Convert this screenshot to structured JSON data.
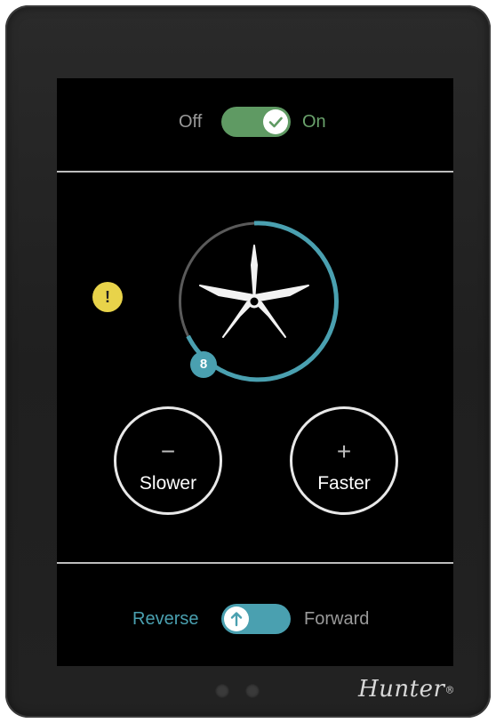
{
  "power": {
    "off_label": "Off",
    "on_label": "On",
    "state": "on"
  },
  "fan": {
    "speed": "8"
  },
  "warning": {
    "symbol": "!"
  },
  "controls": {
    "slower_symbol": "−",
    "slower_label": "Slower",
    "faster_symbol": "+",
    "faster_label": "Faster"
  },
  "direction": {
    "reverse_label": "Reverse",
    "forward_label": "Forward",
    "state": "reverse"
  },
  "brand": {
    "name": "Hunter",
    "mark": "®"
  },
  "colors": {
    "accent_teal": "#4aa0b0",
    "power_green": "#6aa26c",
    "warning_yellow": "#e8d34a"
  }
}
